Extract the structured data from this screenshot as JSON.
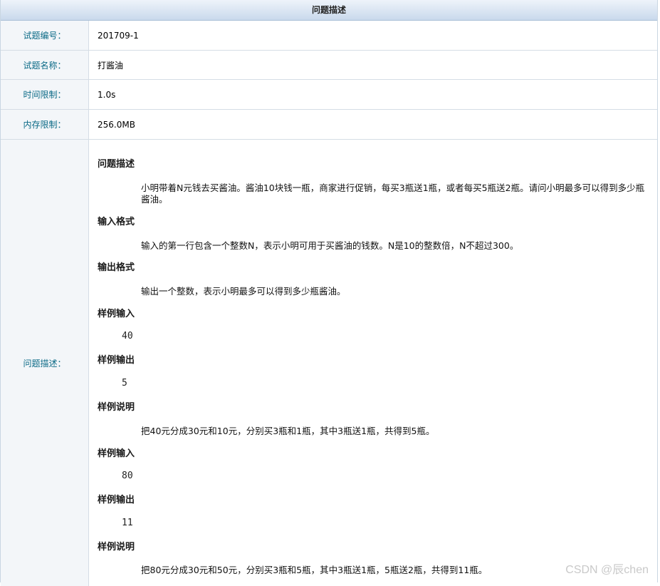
{
  "header": {
    "title": "问题描述"
  },
  "rows": [
    {
      "label": "试题编号：",
      "value": "201709-1"
    },
    {
      "label": "试题名称：",
      "value": "打酱油"
    },
    {
      "label": "时间限制：",
      "value": "1.0s"
    },
    {
      "label": "内存限制：",
      "value": "256.0MB"
    }
  ],
  "description": {
    "label": "问题描述：",
    "sections": {
      "problem_title": "问题描述",
      "problem_text": "小明带着N元钱去买酱油。酱油10块钱一瓶，商家进行促销，每买3瓶送1瓶，或者每买5瓶送2瓶。请问小明最多可以得到多少瓶酱油。",
      "input_title": "输入格式",
      "input_text": "输入的第一行包含一个整数N，表示小明可用于买酱油的钱数。N是10的整数倍，N不超过300。",
      "output_title": "输出格式",
      "output_text": "输出一个整数，表示小明最多可以得到多少瓶酱油。",
      "sample_in_title_1": "样例输入",
      "sample_in_1": "40",
      "sample_out_title_1": "样例输出",
      "sample_out_1": "5",
      "sample_note_title_1": "样例说明",
      "sample_note_1": "把40元分成30元和10元，分别买3瓶和1瓶，其中3瓶送1瓶，共得到5瓶。",
      "sample_in_title_2": "样例输入",
      "sample_in_2": "80",
      "sample_out_title_2": "样例输出",
      "sample_out_2": "11",
      "sample_note_title_2": "样例说明",
      "sample_note_2": "把80元分成30元和50元，分别买3瓶和5瓶，其中3瓶送1瓶，5瓶送2瓶，共得到11瓶。"
    }
  },
  "watermark": "CSDN @辰chen"
}
